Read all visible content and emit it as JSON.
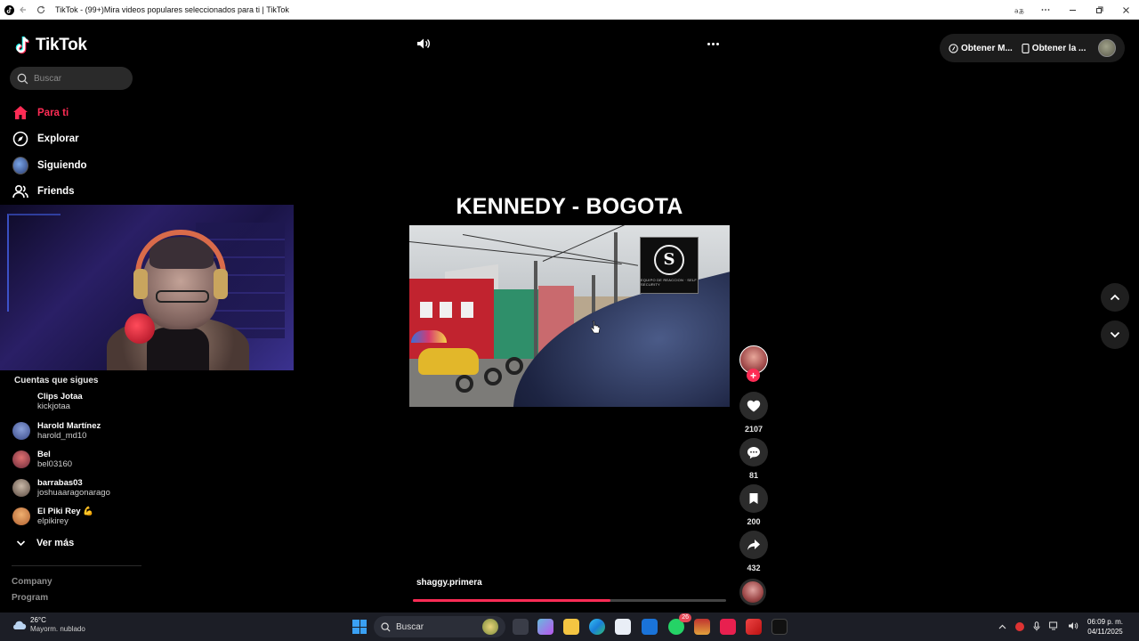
{
  "window": {
    "title": "TikTok - (99+)Mira videos populares seleccionados para ti | TikTok",
    "translate_icon": "translate-icon"
  },
  "brand": {
    "name": "TikTok"
  },
  "search": {
    "placeholder": "Buscar"
  },
  "nav": {
    "items": [
      {
        "label": "Para ti",
        "icon": "home-icon",
        "active": true
      },
      {
        "label": "Explorar",
        "icon": "compass-icon",
        "active": false
      },
      {
        "label": "Siguiendo",
        "icon": "avatar",
        "active": false
      },
      {
        "label": "Friends",
        "icon": "friends-icon",
        "active": false
      }
    ]
  },
  "following": {
    "title": "Cuentas que sigues",
    "accounts": [
      {
        "name": "Clips Jotaa",
        "handle": "kickjotaa"
      },
      {
        "name": "Harold Martínez",
        "handle": "harold_md10"
      },
      {
        "name": "Bel",
        "handle": "bel03160"
      },
      {
        "name": "barrabas03",
        "handle": "joshuaaragonarago"
      },
      {
        "name": "El Piki Rey",
        "handle": "elpikirey"
      }
    ],
    "see_more": "Ver más"
  },
  "footer": {
    "links": [
      "Company",
      "Program"
    ]
  },
  "header": {
    "get_coins": "Obtener M...",
    "get_app": "Obtener la ..."
  },
  "video": {
    "title": "KENNEDY - BOGOTA",
    "username": "shaggy.primera",
    "progress": 0.63,
    "watermark_text": "EQUIPO DE REACCION · SELF SECURITY"
  },
  "actions": {
    "likes": "2107",
    "comments": "81",
    "saves": "200",
    "shares": "432"
  },
  "colors": {
    "accent": "#fe2c55",
    "background": "#000000",
    "taskbar": "#1c1e26"
  },
  "taskbar": {
    "weather_temp": "26°C",
    "weather_desc": "Mayorm. nublado",
    "search_label": "Buscar",
    "whatsapp_badge": "26",
    "time": "06:09 p. m.",
    "date": "04/11/2025"
  }
}
